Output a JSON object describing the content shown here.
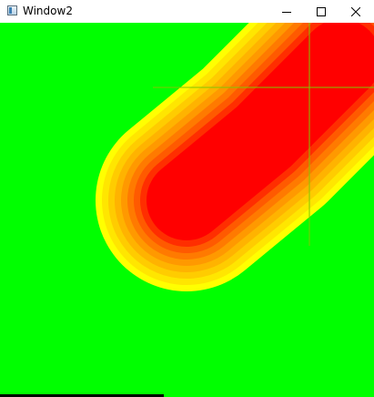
{
  "window": {
    "title": "Window2",
    "app_icon": "window-app-icon",
    "controls": [
      "minimize-icon",
      "maximize-icon",
      "close-icon"
    ]
  },
  "heatmap": {
    "palette": {
      "background": "#00ff00",
      "outer": "#ffff00",
      "core": "#ff0000",
      "bands": [
        "#ffff00",
        "#ffe600",
        "#ffcc00",
        "#ffb300",
        "#ff9900",
        "#ff7a00",
        "#ff5a00",
        "#ff2e00",
        "#ff0000"
      ],
      "crosshair": "#7fc800"
    }
  }
}
